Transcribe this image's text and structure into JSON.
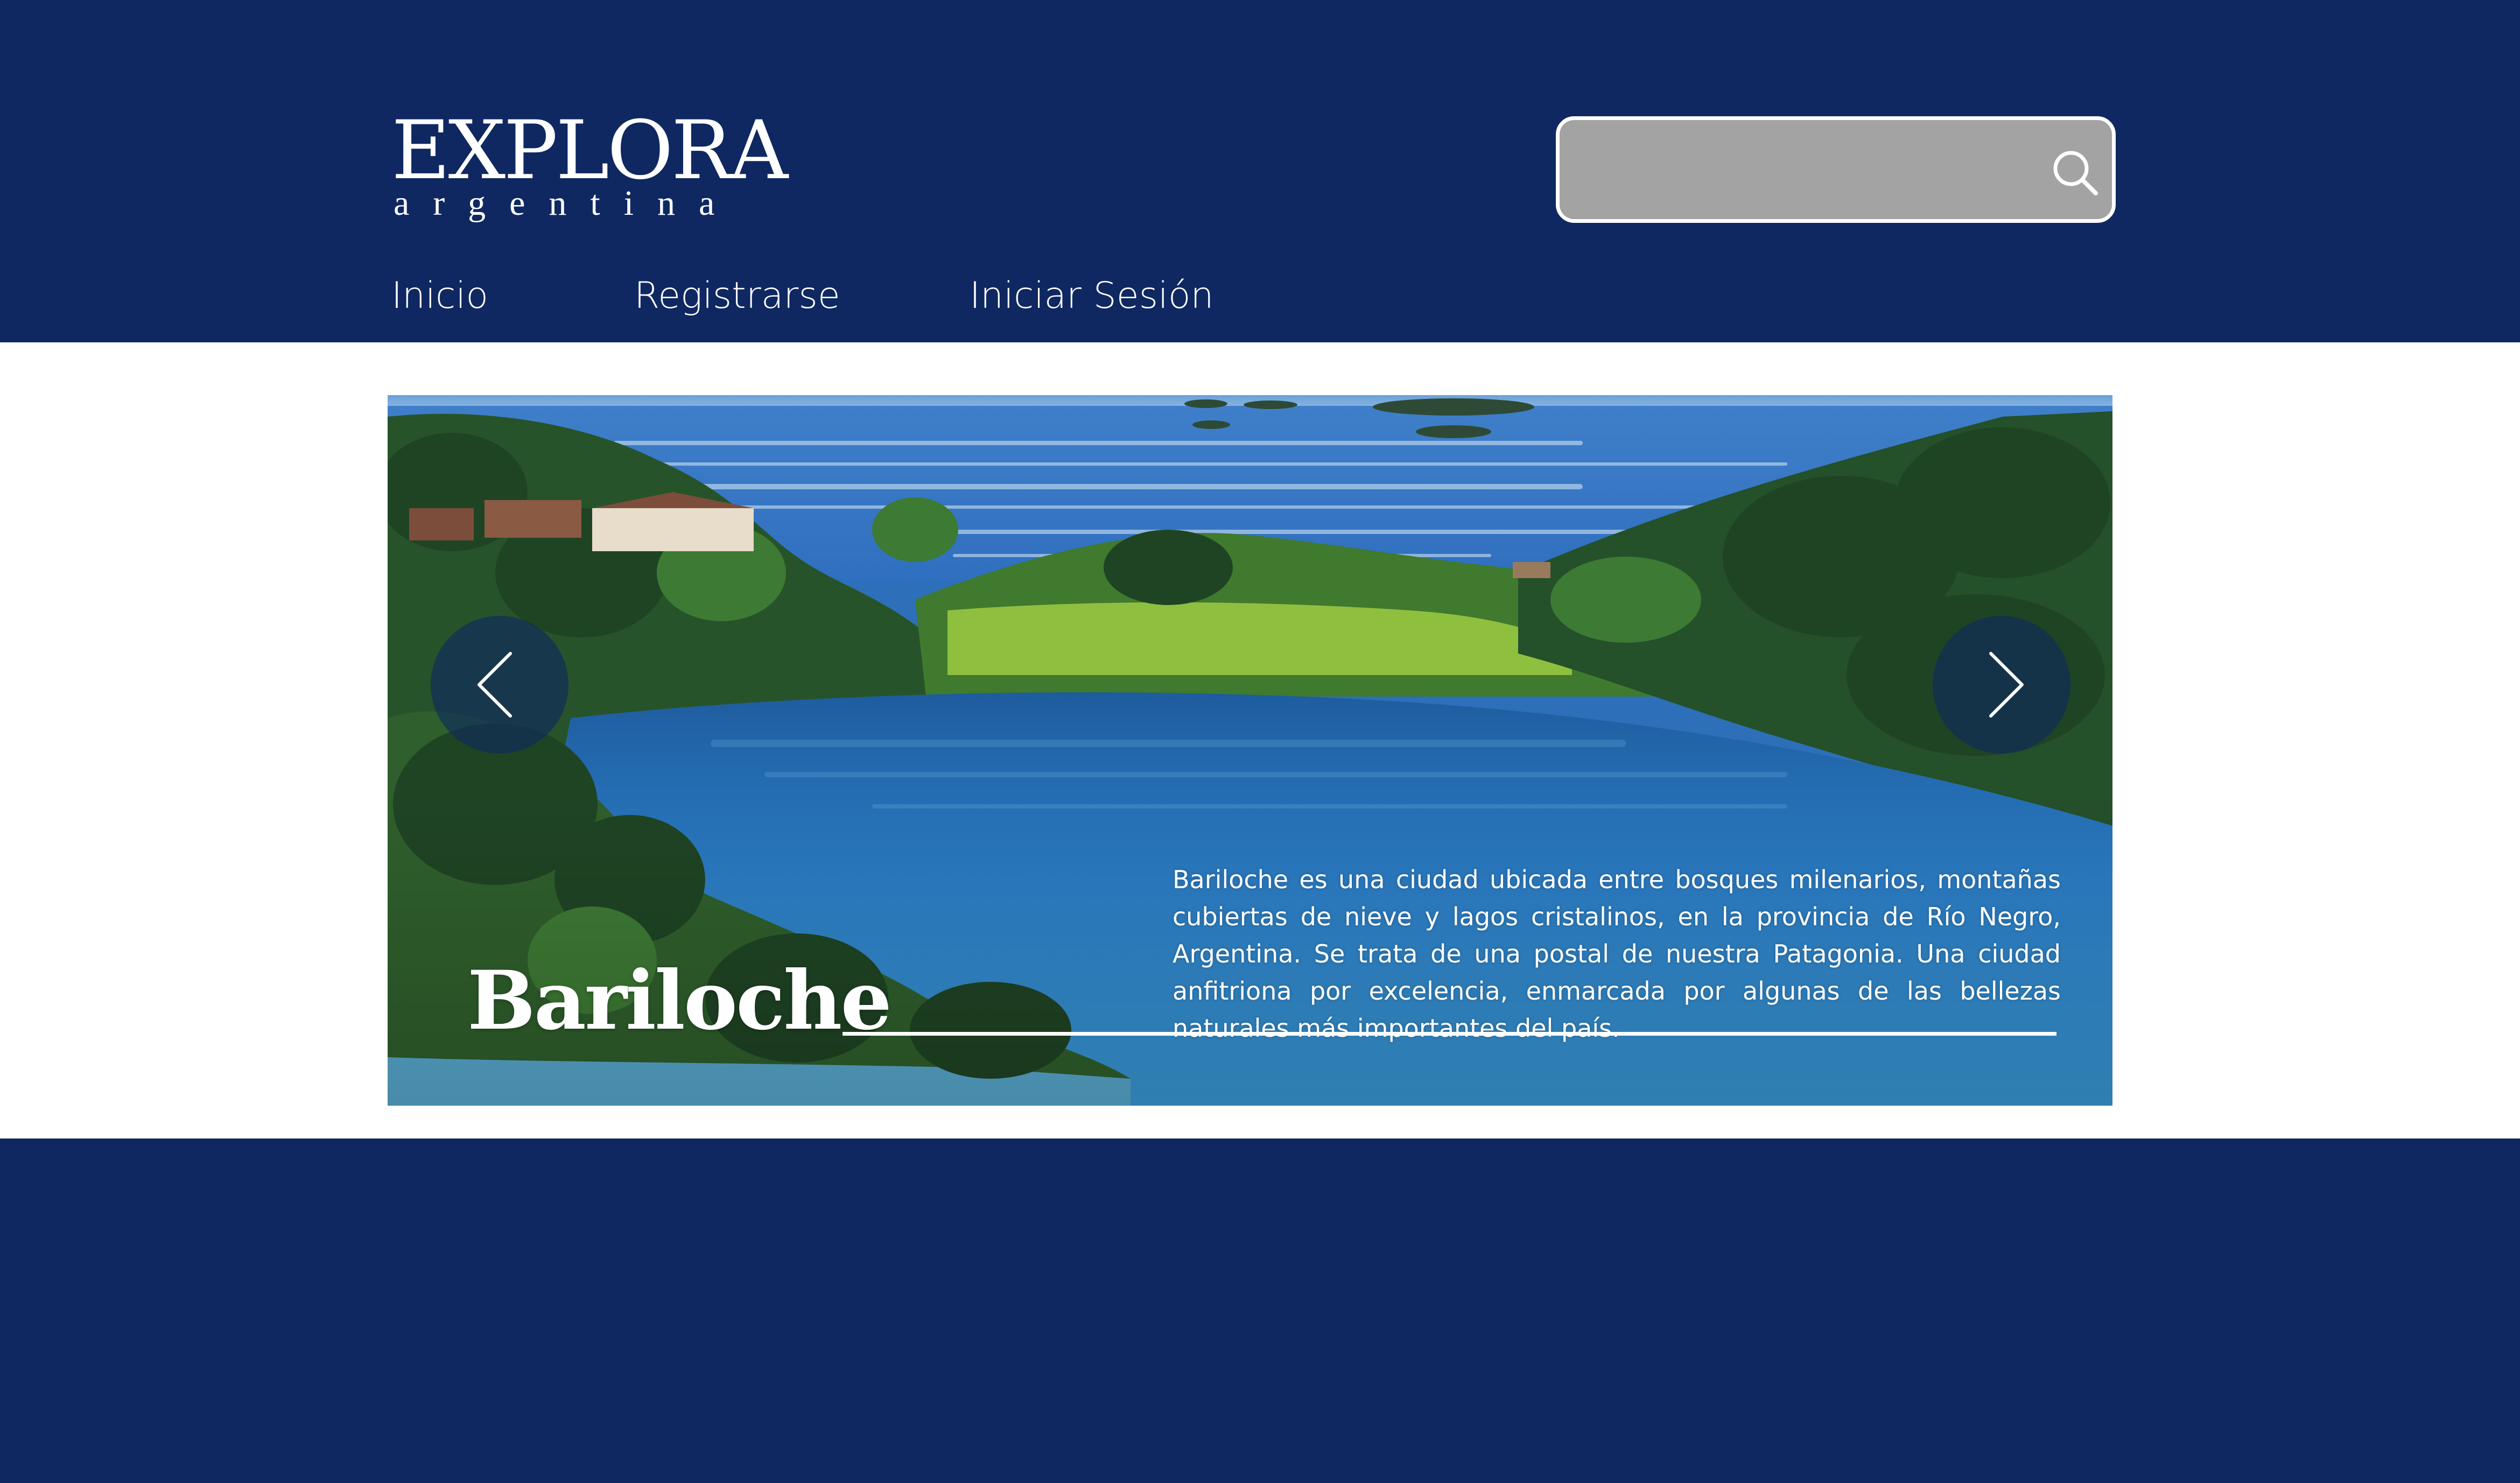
{
  "brand": {
    "logo_main": "EXPLORA",
    "logo_sub": "argentina"
  },
  "search": {
    "value": "",
    "placeholder": "",
    "icon": "search-icon"
  },
  "nav": {
    "items": [
      {
        "label": "Inicio"
      },
      {
        "label": "Registrarse"
      },
      {
        "label": "Iniciar Sesión"
      }
    ]
  },
  "slider": {
    "title": "Bariloche",
    "description": "Bariloche es una ciudad ubicada entre bosques milenarios, montañas cubiertas de nieve y lagos cristalinos, en la provincia de Río Negro, Argentina. Se trata de una postal de nuestra Patagonia. Una ciudad anfitriona por excelencia, enmarcada por algunas de las bellezas naturales más importantes del país.",
    "prev_icon": "chevron-left-icon",
    "next_icon": "chevron-right-icon"
  },
  "colors": {
    "primary": "#0f2861",
    "search_bg": "#a3a3a3",
    "text_light": "#ffffff"
  }
}
